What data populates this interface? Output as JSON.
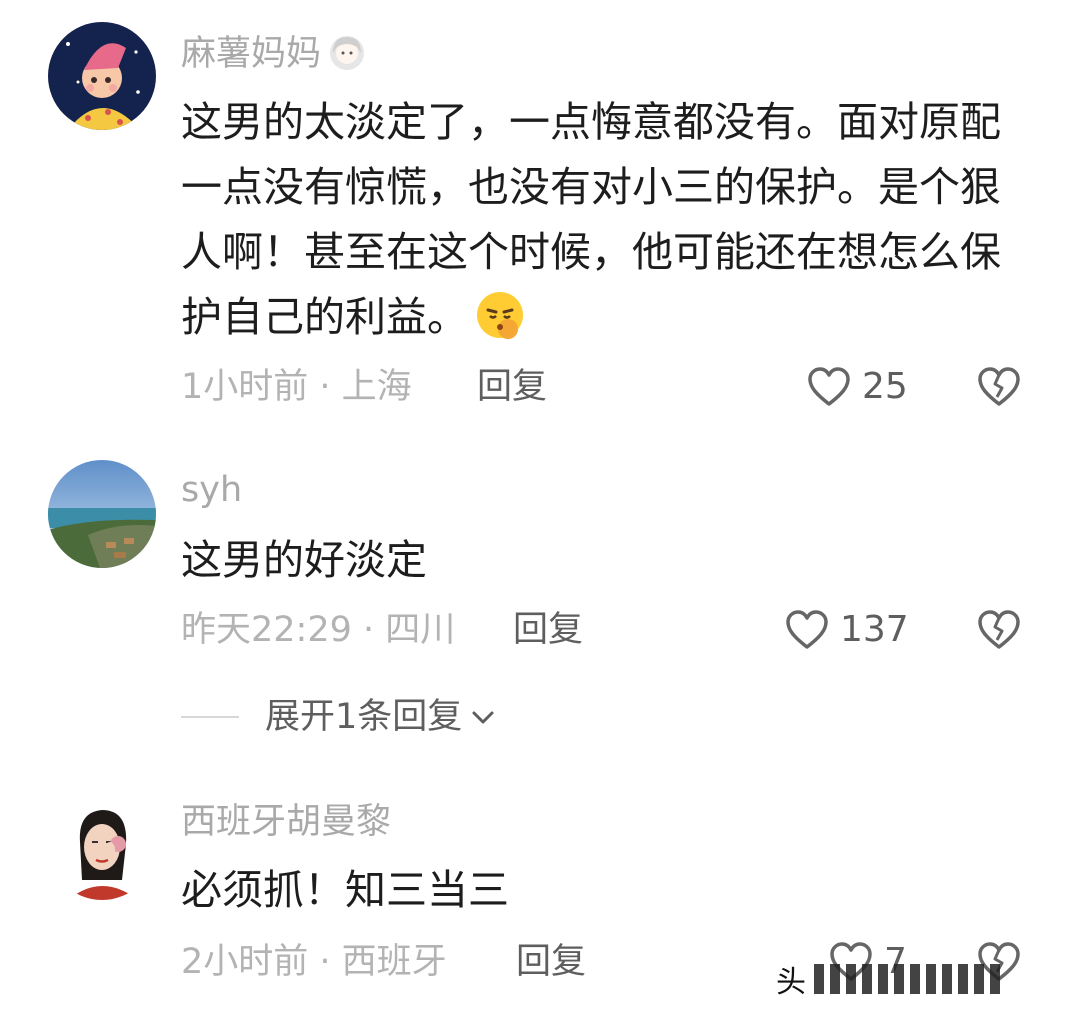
{
  "comments": [
    {
      "username": "麻薯妈妈",
      "content": "这男的太淡定了，一点悔意都没有。面对原配一点没有惊慌，也没有对小三的保护。是个狠人啊！甚至在这个时候，他可能还在想怎么保护自己的利益。",
      "time_location": "1小时前 · 上海",
      "reply_label": "回复",
      "likes": "25",
      "avatar_icon": "cartoon-girl-avatar",
      "emoji_icon": "woman-emoji",
      "content_emoji_icon": "shush-face-emoji"
    },
    {
      "username": "syh",
      "content": "这男的好淡定",
      "time_location": "昨天22:29 · 四川",
      "reply_label": "回复",
      "likes": "137",
      "avatar_icon": "beach-landscape-avatar"
    },
    {
      "username": "西班牙胡曼黎",
      "content": "必须抓！知三当三",
      "time_location": "2小时前 · 西班牙",
      "reply_label": "回复",
      "likes": "7",
      "avatar_icon": "woman-portrait-avatar"
    }
  ],
  "expand_replies": {
    "label": "展开1条回复"
  },
  "watermark": {
    "text": "头"
  },
  "colors": {
    "username": "#a9a9a9",
    "content": "#1d1d1d",
    "meta": "#b3b3b3",
    "action": "#5e5e5e"
  }
}
